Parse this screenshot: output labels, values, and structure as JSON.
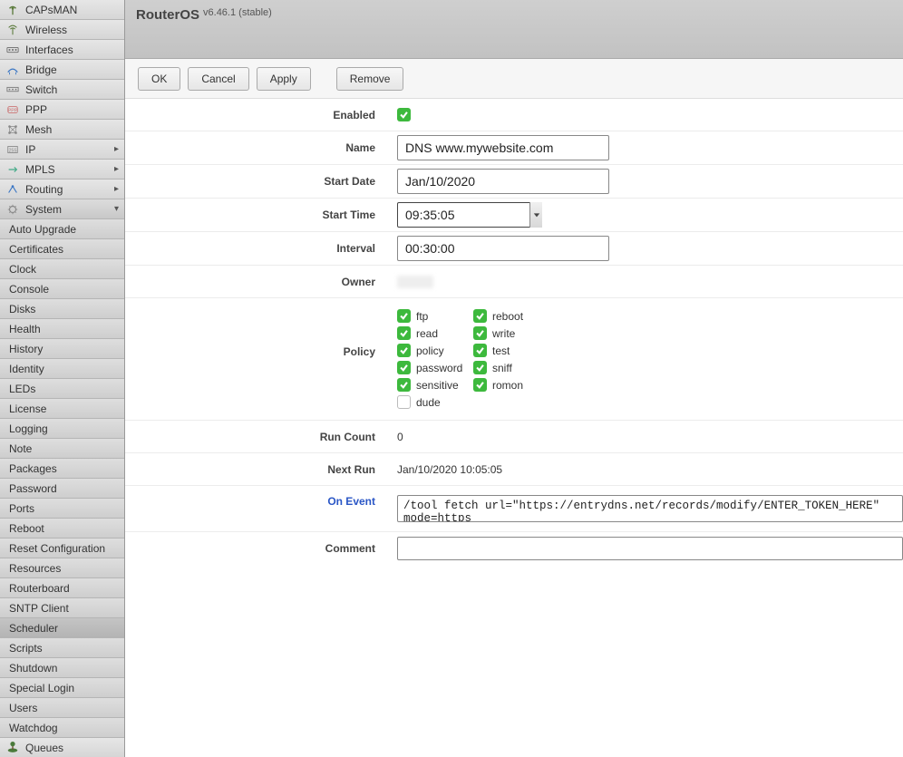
{
  "header": {
    "product": "RouterOS",
    "version": "v6.46.1 (stable)"
  },
  "toolbar": {
    "ok": "OK",
    "cancel": "Cancel",
    "apply": "Apply",
    "remove": "Remove"
  },
  "sidebar": {
    "items": [
      {
        "label": "CAPsMAN",
        "icon": "antenna"
      },
      {
        "label": "Wireless",
        "icon": "antenna2"
      },
      {
        "label": "Interfaces",
        "icon": "interfaces"
      },
      {
        "label": "Bridge",
        "icon": "bridge"
      },
      {
        "label": "Switch",
        "icon": "switch"
      },
      {
        "label": "PPP",
        "icon": "ppp"
      },
      {
        "label": "Mesh",
        "icon": "mesh"
      },
      {
        "label": "IP",
        "icon": "ip",
        "arrow": "▸"
      },
      {
        "label": "MPLS",
        "icon": "mpls",
        "arrow": "▸"
      },
      {
        "label": "Routing",
        "icon": "routing",
        "arrow": "▸"
      },
      {
        "label": "System",
        "icon": "system",
        "arrow": "▾",
        "expanded": true
      }
    ],
    "system_sub": [
      "Auto Upgrade",
      "Certificates",
      "Clock",
      "Console",
      "Disks",
      "Health",
      "History",
      "Identity",
      "LEDs",
      "License",
      "Logging",
      "Note",
      "Packages",
      "Password",
      "Ports",
      "Reboot",
      "Reset Configuration",
      "Resources",
      "Routerboard",
      "SNTP Client",
      "Scheduler",
      "Scripts",
      "Shutdown",
      "Special Login",
      "Users",
      "Watchdog"
    ],
    "system_active": "Scheduler",
    "tail": [
      {
        "label": "Queues",
        "icon": "queues"
      }
    ]
  },
  "form": {
    "labels": {
      "enabled": "Enabled",
      "name": "Name",
      "start_date": "Start Date",
      "start_time": "Start Time",
      "interval": "Interval",
      "owner": "Owner",
      "policy": "Policy",
      "run_count": "Run Count",
      "next_run": "Next Run",
      "on_event": "On Event",
      "comment": "Comment"
    },
    "enabled": true,
    "name": "DNS www.mywebsite.com",
    "start_date": "Jan/10/2020",
    "start_time": "09:35:05",
    "interval": "00:30:00",
    "owner": "",
    "policy": [
      {
        "label": "ftp",
        "checked": true
      },
      {
        "label": "reboot",
        "checked": true
      },
      {
        "label": "read",
        "checked": true
      },
      {
        "label": "write",
        "checked": true
      },
      {
        "label": "policy",
        "checked": true
      },
      {
        "label": "test",
        "checked": true
      },
      {
        "label": "password",
        "checked": true
      },
      {
        "label": "sniff",
        "checked": true
      },
      {
        "label": "sensitive",
        "checked": true
      },
      {
        "label": "romon",
        "checked": true
      },
      {
        "label": "dude",
        "checked": false
      }
    ],
    "run_count": "0",
    "next_run": "Jan/10/2020 10:05:05",
    "on_event": "/tool fetch url=\"https://entrydns.net/records/modify/ENTER_TOKEN_HERE\" mode=https",
    "comment": ""
  }
}
